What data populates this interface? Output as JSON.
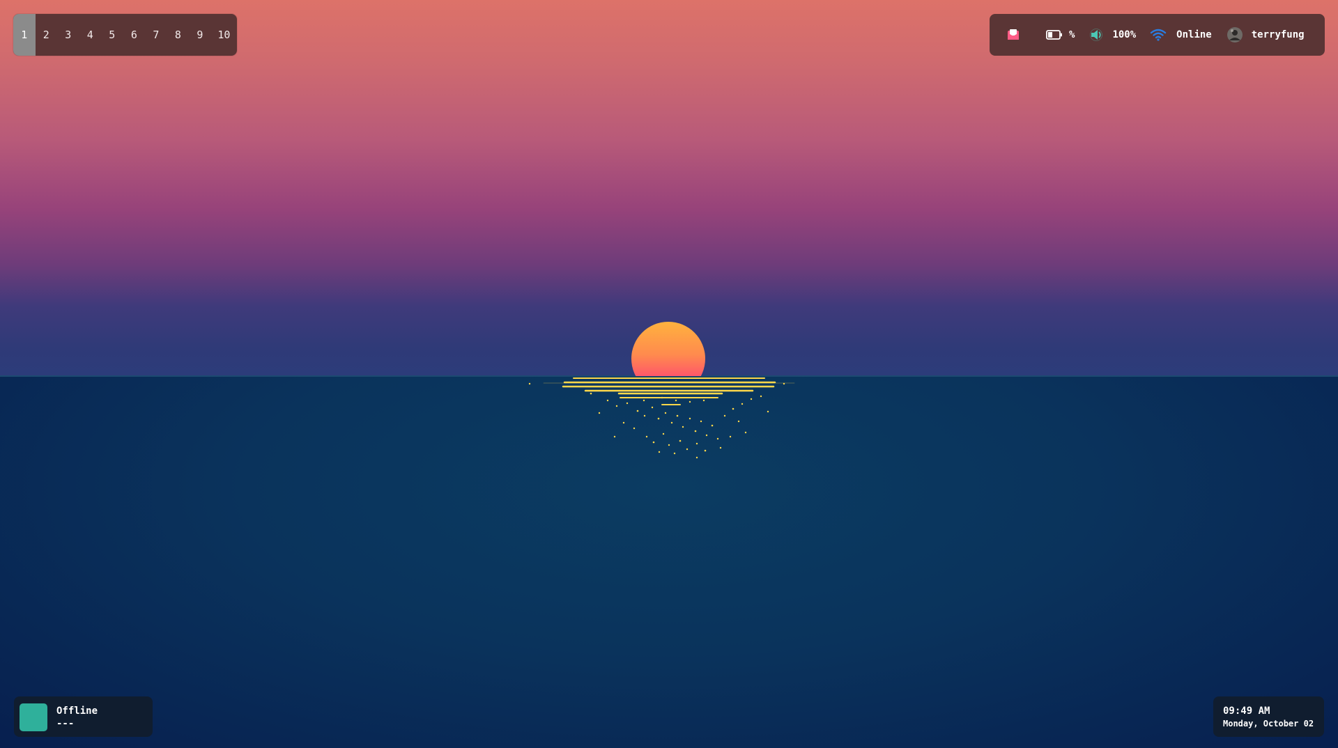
{
  "workspaces": {
    "items": [
      "1",
      "2",
      "3",
      "4",
      "5",
      "6",
      "7",
      "8",
      "9",
      "10"
    ],
    "active": "1"
  },
  "tray": {
    "mail_icon": "mail-icon",
    "battery_icon": "battery-icon",
    "battery_text": "%",
    "volume_icon": "volume-icon",
    "volume_text": "100%",
    "wifi_icon": "wifi-icon",
    "network_text": "Online",
    "user_avatar_icon": "avatar-icon",
    "username": "terryfung"
  },
  "media": {
    "status": "Offline",
    "detail": "---"
  },
  "clock": {
    "time": "09:49 AM",
    "date": "Monday, October 02"
  },
  "colors": {
    "bar_background": "#5a3535",
    "widget_background": "#101d2f",
    "active_workspace": "#8b8b8b",
    "media_art": "#2fb09b",
    "wifi_blue": "#2a7de1",
    "volume_teal": "#4cc7b4",
    "mail_pink": "#ff5c86"
  }
}
